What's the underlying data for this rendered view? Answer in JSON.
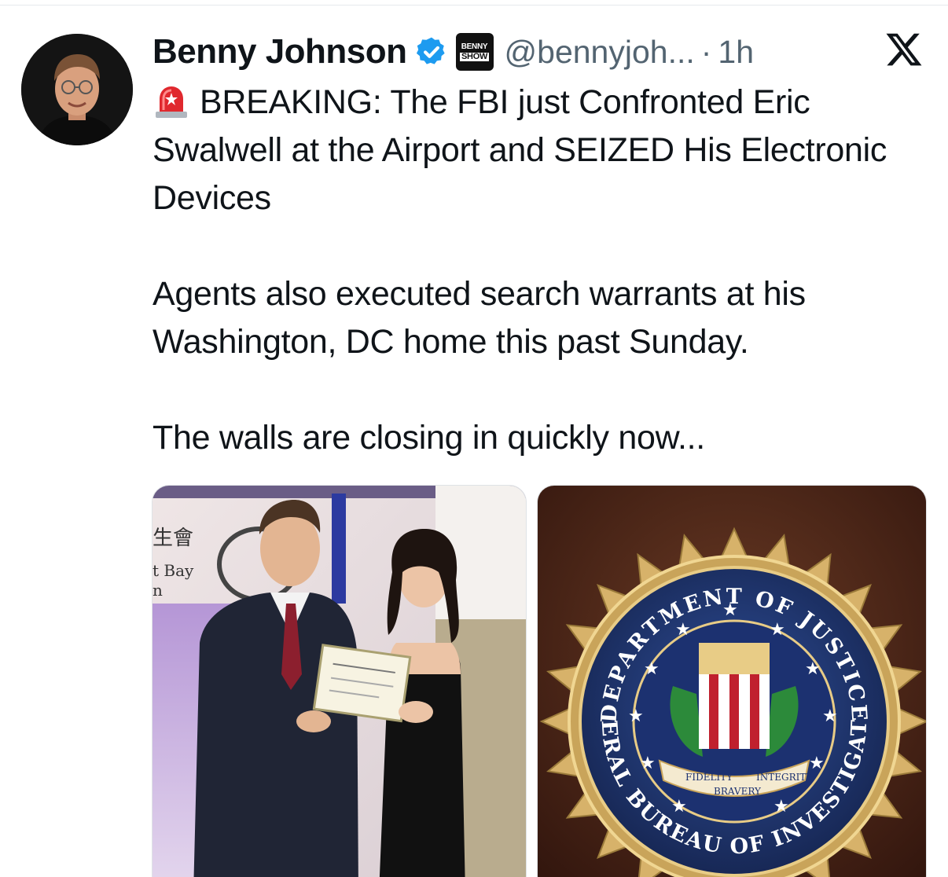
{
  "author": {
    "display_name": "Benny Johnson",
    "handle": "@bennyjoh...",
    "separator": "·",
    "time": "1h",
    "affiliation_badge": [
      "BENNY",
      "SHOW"
    ],
    "verified_color": "#1d9bf0"
  },
  "tweet": {
    "paragraph_1": "BREAKING: The FBI just Confronted Eric Swalwell at the Airport and SEIZED His Electronic Devices",
    "paragraph_2": "Agents also executed search warrants at his Washington, DC home this past Sunday.",
    "paragraph_3": "The walls are closing in quickly now..."
  },
  "media": {
    "left_photo": {
      "sign_text_1": "生會",
      "sign_text_2": "t Bay",
      "sign_text_3": "n"
    },
    "right_photo": {
      "seal_top": "DEPARTMENT OF JUSTICE",
      "seal_bottom": "FEDERAL BUREAU OF INVESTIGATION",
      "ribbon_left": "FIDELITY",
      "ribbon_center": "BRAVERY",
      "ribbon_right": "INTEGRITY"
    }
  },
  "icons": {
    "siren": "siren-icon",
    "verified": "verified-badge-icon",
    "x_logo": "x-logo-icon"
  }
}
